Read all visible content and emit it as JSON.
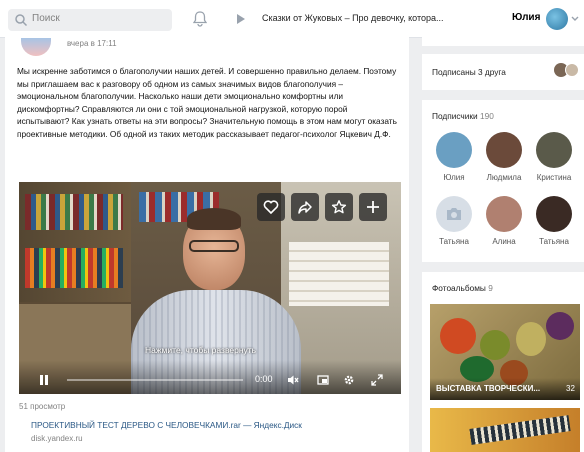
{
  "header": {
    "search_placeholder": "Поиск",
    "now_playing": "Сказки от Жуковых – Про девочку, котора...",
    "user_name": "Юлия"
  },
  "post": {
    "time": "вчера в 17:11",
    "text": "Мы искренне заботимся о благополучии наших детей. И совершенно правильно делаем. Поэтому мы приглашаем вас к разговору об одном из самых значимых видов благополучия – эмоциональном благополучии. Насколько наши дети эмоционально комфортны или дискомфортны? Справляются ли они с той эмоциональной нагрузкой, которую порой испытывают? Как узнать ответы на эти вопросы? Значительную помощь в этом нам могут оказать проективные методики. Об одной из таких методик рассказывает педагог-психолог Яцкевич Д.Ф.",
    "video": {
      "expand_hint": "Нажмите, чтобы развернуть",
      "time": "0:00",
      "progress": 0.0
    },
    "views": "51 просмотр",
    "attachment": {
      "title": "ПРОЕКТИВНЫЙ ТЕСТ ДЕРЕВО С ЧЕЛОВЕЧКАМИ.rar — Яндекс.Диск",
      "host": "disk.yandex.ru"
    }
  },
  "sidebar": {
    "friends_label": "Подписаны 3 друга",
    "subscribers": {
      "label": "Подписчики",
      "count": "190",
      "people": [
        {
          "name": "Юлия",
          "color": "#6a9fc2"
        },
        {
          "name": "Людмила",
          "color": "#6b4a3a"
        },
        {
          "name": "Кристина",
          "color": "#5a5a4a"
        },
        {
          "name": "Татьяна",
          "color": "#d7dee6"
        },
        {
          "name": "Алина",
          "color": "#b08070"
        },
        {
          "name": "Татьяна",
          "color": "#3a2a24"
        }
      ]
    },
    "photos": {
      "label": "Фотоальбомы",
      "count": "9",
      "album_title": "ВЫСТАВКА ТВОРЧЕСКИ...",
      "album_count": "32"
    }
  }
}
